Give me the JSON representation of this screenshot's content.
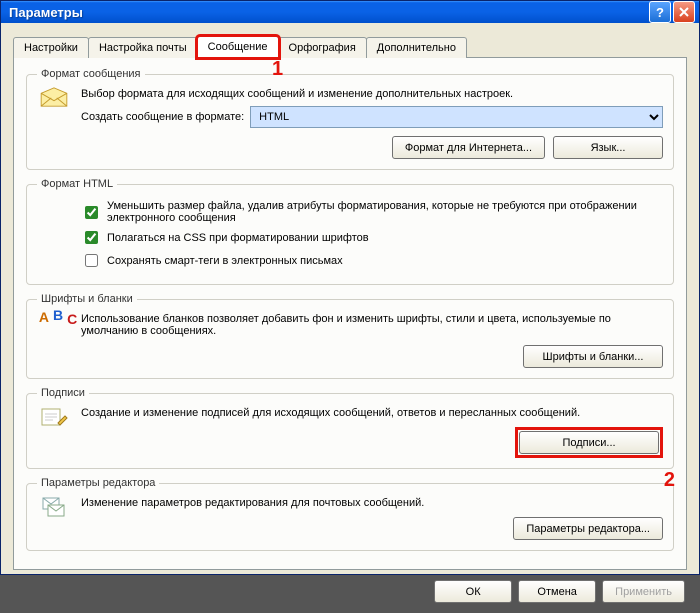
{
  "window": {
    "title": "Параметры"
  },
  "tabs": {
    "settings": "Настройки",
    "mail_setup": "Настройка почты",
    "message": "Сообщение",
    "spelling": "Орфография",
    "advanced": "Дополнительно"
  },
  "markers": {
    "one": "1",
    "two": "2"
  },
  "message_format": {
    "legend": "Формат сообщения",
    "desc": "Выбор формата для исходящих сообщений и изменение дополнительных настроек.",
    "compose_label": "Создать сообщение в формате:",
    "compose_value": "HTML",
    "btn_internet": "Формат для Интернета...",
    "btn_lang": "Язык..."
  },
  "html_format": {
    "legend": "Формат HTML",
    "chk_reduce": "Уменьшить размер файла, удалив атрибуты форматирования, которые не требуются при отображении электронного сообщения",
    "chk_css": "Полагаться на CSS при форматировании шрифтов",
    "chk_smarttags": "Сохранять смарт-теги в электронных письмах"
  },
  "fonts": {
    "legend": "Шрифты и бланки",
    "desc": "Использование бланков позволяет добавить фон и изменить шрифты, стили и цвета, используемые по умолчанию в сообщениях.",
    "btn": "Шрифты и бланки..."
  },
  "signatures": {
    "legend": "Подписи",
    "desc": "Создание и изменение подписей для исходящих сообщений, ответов и пересланных сообщений.",
    "btn": "Подписи..."
  },
  "editor": {
    "legend": "Параметры редактора",
    "desc": "Изменение параметров редактирования для почтовых сообщений.",
    "btn": "Параметры редактора..."
  },
  "buttons": {
    "ok": "ОК",
    "cancel": "Отмена",
    "apply": "Применить"
  }
}
